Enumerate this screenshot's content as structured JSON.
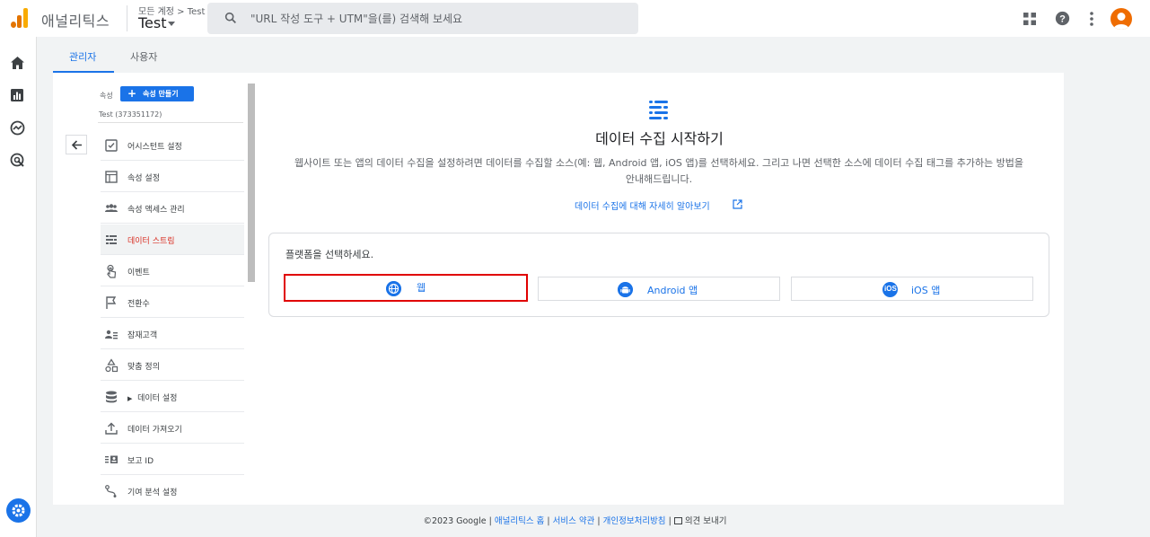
{
  "app": {
    "name": "애널리틱스",
    "brand_colors": [
      "#f9ab00",
      "#e37400"
    ]
  },
  "account": {
    "breadcrumb": "모든 계정 > Test",
    "property_name": "Test"
  },
  "search": {
    "placeholder": "\"URL 작성 도구 + UTM\"을(를) 검색해 보세요"
  },
  "toolbar": {
    "icons": [
      "apps-grid-icon",
      "help-icon",
      "more-vert-icon",
      "avatar"
    ]
  },
  "rail": {
    "items": [
      "home-icon",
      "reports-icon",
      "explore-icon",
      "advertising-icon",
      "admin-settings-icon"
    ]
  },
  "tabs": [
    {
      "label": "관리자",
      "active": true
    },
    {
      "label": "사용자",
      "active": false
    }
  ],
  "property_panel": {
    "label": "속성",
    "create_button": "속성 만들기",
    "property_id": "Test (373351172)",
    "items": [
      {
        "label": "어시스턴트 설정",
        "icon": "checklist-icon"
      },
      {
        "label": "속성 설정",
        "icon": "property-settings-icon"
      },
      {
        "label": "속성 액세스 관리",
        "icon": "people-icon"
      },
      {
        "label": "데이터 스트림",
        "icon": "data-stream-icon",
        "active": true
      },
      {
        "label": "이벤트",
        "icon": "touch-icon"
      },
      {
        "label": "전환수",
        "icon": "flag-icon"
      },
      {
        "label": "잠재고객",
        "icon": "audience-icon"
      },
      {
        "label": "맞춤 정의",
        "icon": "shapes-icon"
      },
      {
        "label": "데이터 설정",
        "icon": "database-icon",
        "expandable": true
      },
      {
        "label": "데이터 가져오기",
        "icon": "upload-icon"
      },
      {
        "label": "보고 ID",
        "icon": "reporting-id-icon"
      },
      {
        "label": "기여 분석 설정",
        "icon": "attribution-icon"
      }
    ]
  },
  "main": {
    "title": "데이터 수집 시작하기",
    "description": "웹사이트 또는 앱의 데이터 수집을 설정하려면 데이터를 수집할 소스(예: 웹, Android 앱, iOS 앱)를 선택하세요. 그리고 나면 선택한 소스에 데이터 수집 태그를 추가하는 방법을 안내해드립니다.",
    "learn_more": "데이터 수집에 대해 자세히 알아보기",
    "platform_title": "플랫폼을 선택하세요.",
    "platforms": [
      {
        "label": "웹",
        "icon": "globe-icon",
        "highlighted": true
      },
      {
        "label": "Android 앱",
        "icon": "android-icon"
      },
      {
        "label": "iOS 앱",
        "icon": "ios-icon"
      }
    ]
  },
  "footer": {
    "copyright": "©2023 Google |",
    "home": "애널리틱스 홈",
    "terms": "서비스 약관",
    "privacy": "개인정보처리방침",
    "sep": "|",
    "feedback": "의견 보내기"
  },
  "colors": {
    "accent": "#1a73e8",
    "highlight_border": "#e00000",
    "active_item": "#d93025"
  }
}
